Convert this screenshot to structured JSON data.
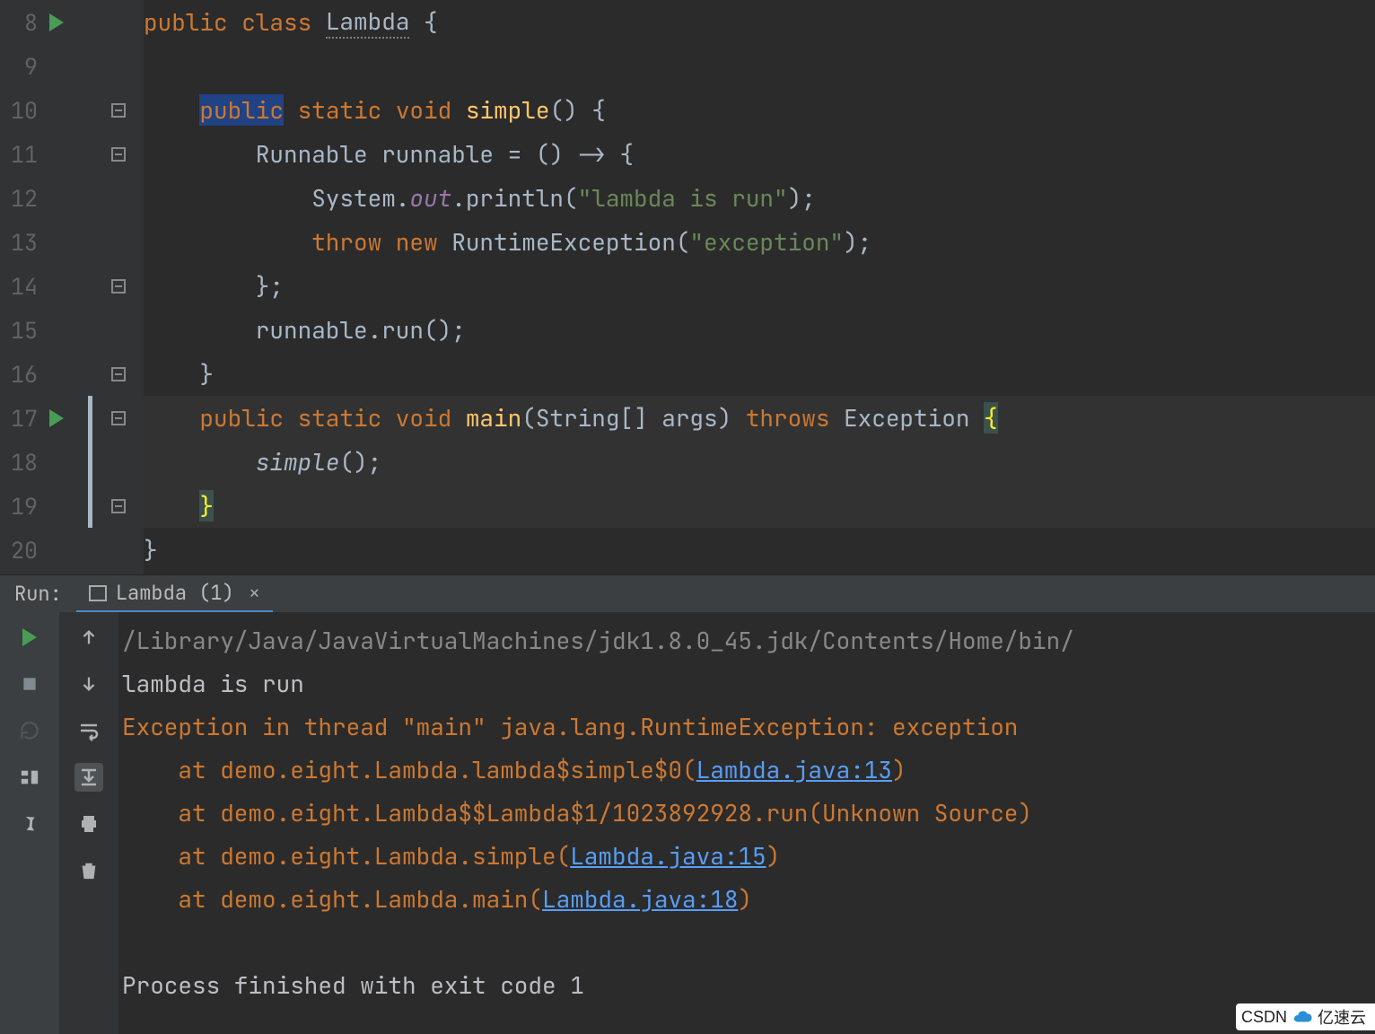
{
  "editor": {
    "lines": [
      {
        "n": 8,
        "run": true,
        "fold": "",
        "tokens": [
          [
            "",
            "public ",
            " ",
            "kw"
          ],
          [
            "",
            "class ",
            "",
            "kw"
          ],
          [
            "cls underline",
            "Lambda",
            "",
            ""
          ],
          [
            "",
            " {",
            "",
            ""
          ]
        ]
      },
      {
        "n": 9,
        "run": false,
        "fold": "",
        "tokens": [
          [
            "",
            "",
            "",
            ""
          ]
        ]
      },
      {
        "n": 10,
        "run": false,
        "fold": "minus",
        "tokens": [
          [
            "",
            "    ",
            "",
            ""
          ],
          [
            "sel-hl kw",
            "public",
            "",
            ""
          ],
          [
            "",
            " ",
            "",
            ""
          ],
          [
            "kw",
            "static ",
            "",
            ""
          ],
          [
            "kw",
            "void ",
            "",
            ""
          ],
          [
            "mth",
            "simple",
            "",
            ""
          ],
          [
            "",
            "() {",
            "",
            ""
          ]
        ]
      },
      {
        "n": 11,
        "run": false,
        "fold": "minus",
        "tokens": [
          [
            "",
            "        Runnable runnable = () -> {",
            "",
            ""
          ]
        ]
      },
      {
        "n": 12,
        "run": false,
        "fold": "line",
        "tokens": [
          [
            "",
            "            System.",
            "",
            ""
          ],
          [
            "fld",
            "out",
            "",
            ""
          ],
          [
            "",
            ".println(",
            "",
            ""
          ],
          [
            "str",
            "\"lambda is run\"",
            "",
            ""
          ],
          [
            "",
            ");",
            "",
            ""
          ]
        ]
      },
      {
        "n": 13,
        "run": false,
        "fold": "line",
        "tokens": [
          [
            "",
            "            ",
            "",
            ""
          ],
          [
            "kw",
            "throw new ",
            "",
            ""
          ],
          [
            "",
            "RuntimeException(",
            "",
            ""
          ],
          [
            "str",
            "\"exception\"",
            "",
            ""
          ],
          [
            "",
            ");",
            "",
            ""
          ]
        ]
      },
      {
        "n": 14,
        "run": false,
        "fold": "minus",
        "tokens": [
          [
            "",
            "        };",
            "",
            ""
          ]
        ]
      },
      {
        "n": 15,
        "run": false,
        "fold": "line",
        "tokens": [
          [
            "",
            "        runnable.run();",
            "",
            ""
          ]
        ]
      },
      {
        "n": 16,
        "run": false,
        "fold": "minus",
        "tokens": [
          [
            "",
            "    }",
            "",
            ""
          ]
        ]
      },
      {
        "n": 17,
        "run": true,
        "fold": "minus",
        "tokens": [
          [
            "",
            "    ",
            "",
            ""
          ],
          [
            "kw",
            "public static void ",
            "",
            ""
          ],
          [
            "mth",
            "main",
            "",
            ""
          ],
          [
            "",
            "(String[] args) ",
            "",
            ""
          ],
          [
            "kw",
            "throws ",
            "",
            ""
          ],
          [
            "",
            "Exception ",
            "",
            ""
          ],
          [
            "brm",
            "{",
            "",
            ""
          ]
        ]
      },
      {
        "n": 18,
        "run": false,
        "fold": "line",
        "tokens": [
          [
            "",
            "        ",
            "",
            ""
          ],
          [
            "it",
            "simple",
            "",
            ""
          ],
          [
            "",
            "();",
            "",
            ""
          ]
        ]
      },
      {
        "n": 19,
        "run": false,
        "fold": "minus",
        "tokens": [
          [
            "",
            "    ",
            "",
            ""
          ],
          [
            "brm",
            "}",
            "",
            ""
          ]
        ]
      },
      {
        "n": 20,
        "run": false,
        "fold": "",
        "tokens": [
          [
            "",
            "}",
            "",
            ""
          ]
        ]
      }
    ],
    "current_start": 17,
    "current_end": 19
  },
  "run": {
    "label": "Run:",
    "tab": "Lambda (1)",
    "lines": [
      {
        "t": "path",
        "v": "/Library/Java/JavaVirtualMachines/jdk1.8.0_45.jdk/Contents/Home/bin/"
      },
      {
        "t": "out",
        "v": "lambda is run"
      },
      {
        "t": "err",
        "v": "Exception in thread \"main\" java.lang.RuntimeException: exception"
      },
      {
        "t": "trace",
        "pre": "    at demo.eight.Lambda.lambda$simple$0(",
        "link": "Lambda.java:13",
        "post": ")"
      },
      {
        "t": "err",
        "v": "    at demo.eight.Lambda$$Lambda$1/1023892928.run(Unknown Source)"
      },
      {
        "t": "trace",
        "pre": "    at demo.eight.Lambda.simple(",
        "link": "Lambda.java:15",
        "post": ")"
      },
      {
        "t": "trace",
        "pre": "    at demo.eight.Lambda.main(",
        "link": "Lambda.java:18",
        "post": ")"
      },
      {
        "t": "blank",
        "v": ""
      },
      {
        "t": "out",
        "v": "Process finished with exit code 1"
      }
    ]
  },
  "watermark": {
    "left": "CSDN",
    "right": "亿速云"
  }
}
